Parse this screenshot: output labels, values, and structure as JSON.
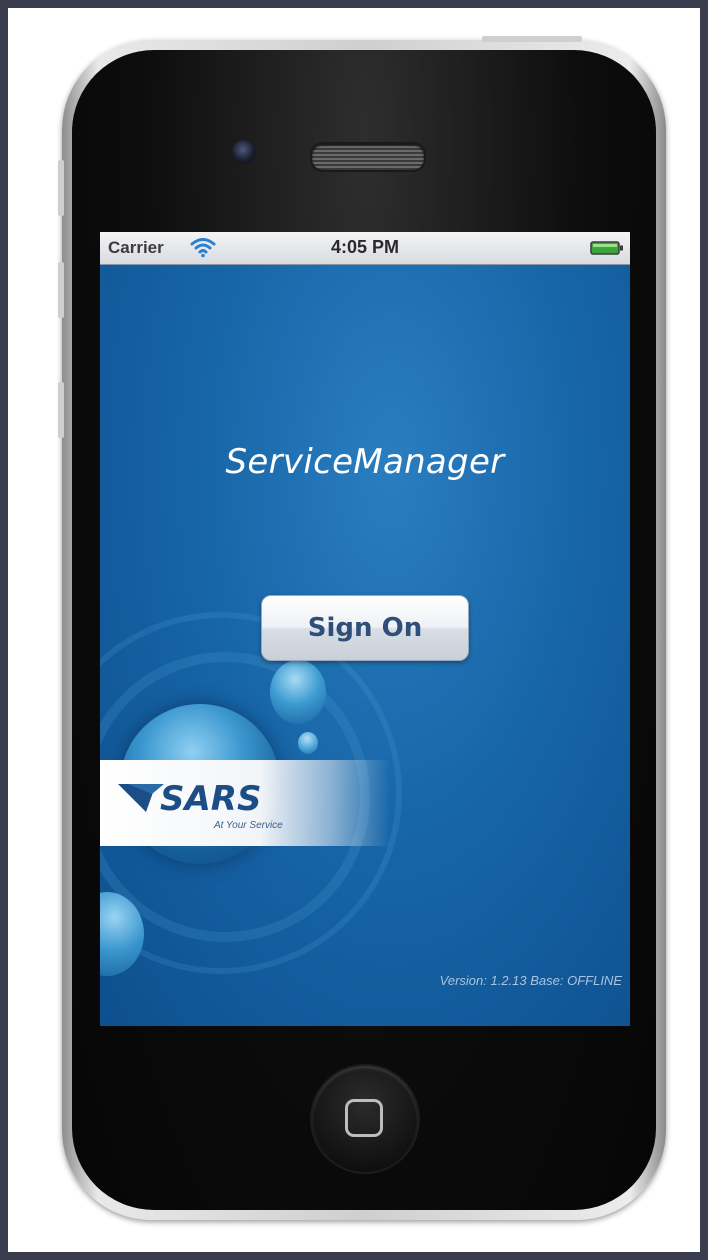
{
  "status_bar": {
    "carrier": "Carrier",
    "time": "4:05 PM",
    "wifi_icon": "wifi-icon",
    "battery_icon": "battery-icon"
  },
  "app": {
    "title": "ServiceManager",
    "sign_on_label": "Sign On",
    "logo_text": "SARS",
    "logo_tagline": "At Your Service",
    "version_text": "Version: 1.2.13 Base: OFFLINE"
  },
  "colors": {
    "screen_blue": "#1766a8",
    "button_text": "#2f4e7a"
  }
}
